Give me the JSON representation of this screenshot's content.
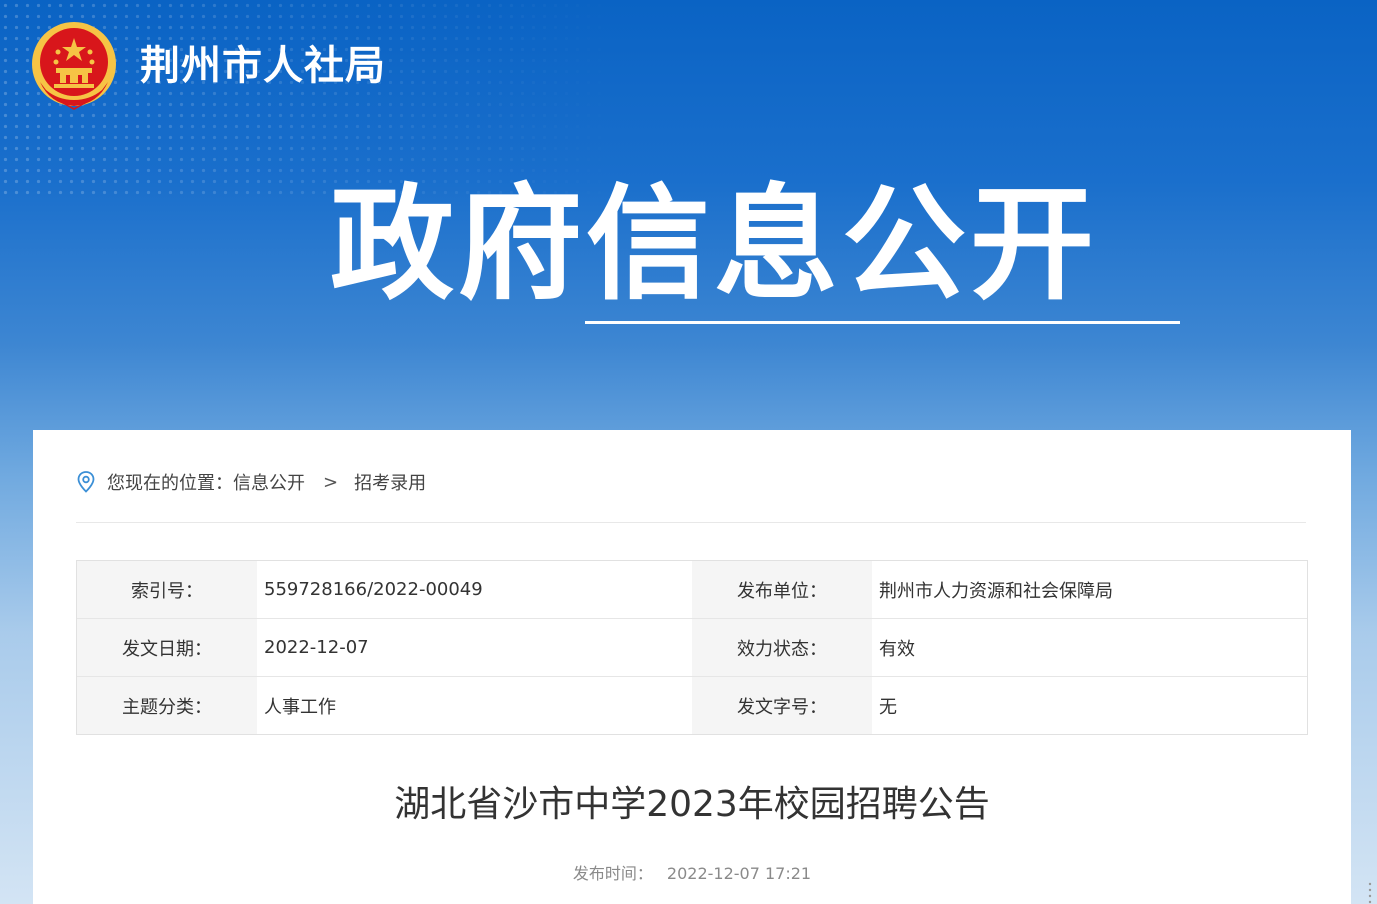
{
  "header": {
    "site_name": "荆州市人社局",
    "hero_title": "政府信息公开"
  },
  "breadcrumb": {
    "prefix": "您现在的位置：",
    "items": [
      "信息公开",
      "招考录用"
    ],
    "separator": ">"
  },
  "meta": {
    "rows": [
      [
        {
          "key": "索引号：",
          "value": "559728166/2022-00049"
        },
        {
          "key": "发布单位：",
          "value": "荆州市人力资源和社会保障局"
        }
      ],
      [
        {
          "key": "发文日期：",
          "value": "2022-12-07"
        },
        {
          "key": "效力状态：",
          "value": "有效"
        }
      ],
      [
        {
          "key": "主题分类：",
          "value": "人事工作"
        },
        {
          "key": "发文字号：",
          "value": "无"
        }
      ]
    ]
  },
  "article": {
    "title": "湖北省沙市中学2023年校园招聘公告",
    "publish_label": "发布时间：",
    "publish_time": "2022-12-07 17:21"
  },
  "colors": {
    "banner_top": "#0a63c4",
    "banner_bottom": "#d3e4f4",
    "emblem_red": "#d8161b",
    "emblem_gold": "#f6c445",
    "pin_blue": "#3b8fd6"
  }
}
